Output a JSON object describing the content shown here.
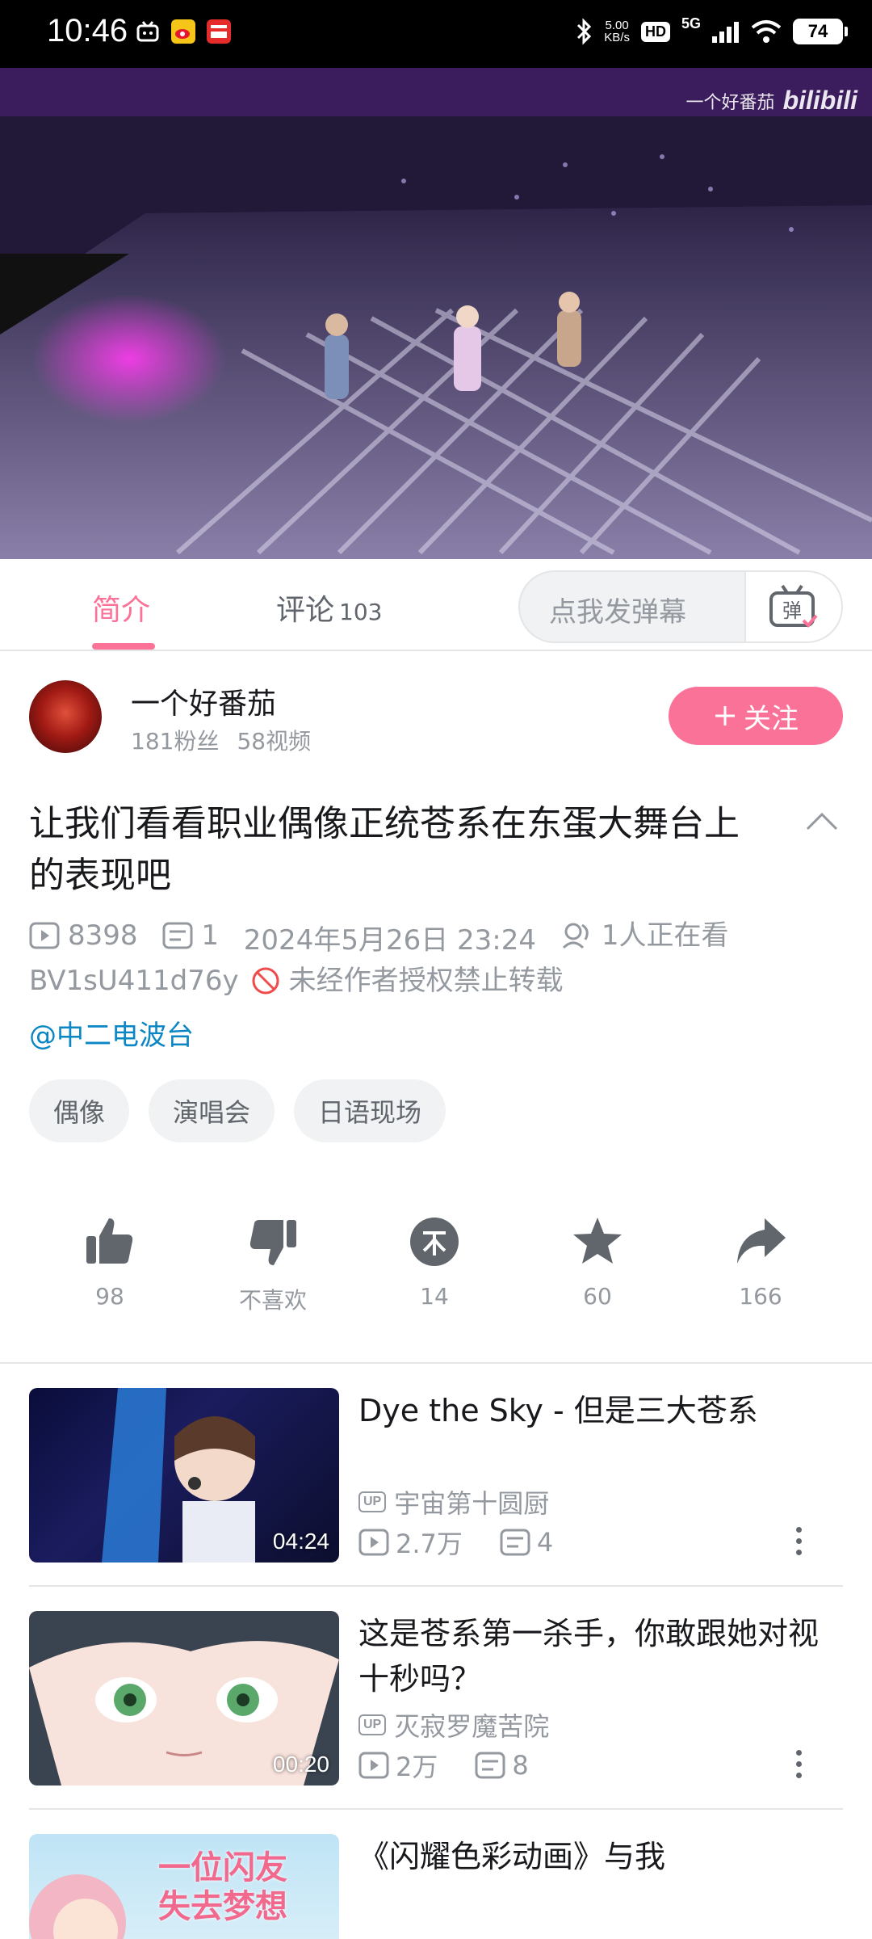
{
  "status_bar": {
    "time": "10:46",
    "speed_value": "5.00",
    "speed_unit": "KB/s",
    "hd": "HD",
    "network": "5G",
    "battery": "74"
  },
  "video": {
    "watermark_name": "一个好番茄",
    "watermark_logo": "bilibili"
  },
  "tabs": {
    "intro": "简介",
    "comments": "评论",
    "comments_count": "103",
    "danmu_placeholder": "点我发弹幕",
    "danmu_button": "弹"
  },
  "uploader": {
    "name": "一个好番茄",
    "fans": "181粉丝",
    "videos": "58视频",
    "follow": "关注"
  },
  "title": "让我们看看职业偶像正统苍系在东蛋大舞台上的表现吧",
  "meta": {
    "plays": "8398",
    "danmaku": "1",
    "date": "2024年5月26日 23:24",
    "watching": "1人正在看",
    "bvid": "BV1sU411d76y",
    "copyright": "未经作者授权禁止转载",
    "mention": "@中二电波台"
  },
  "tags": [
    "偶像",
    "演唱会",
    "日语现场"
  ],
  "actions": {
    "like": "98",
    "dislike": "不喜欢",
    "coin": "14",
    "favorite": "60",
    "share": "166"
  },
  "related": [
    {
      "title": "Dye the Sky - 但是三大苍系",
      "duration": "04:24",
      "up": "宇宙第十圆厨",
      "plays": "2.7万",
      "danmaku": "4"
    },
    {
      "title": "这是苍系第一杀手，你敢跟她对视十秒吗？",
      "duration": "00:20",
      "up": "灭寂罗魔苦院",
      "plays": "2万",
      "danmaku": "8"
    },
    {
      "title": "《闪耀色彩动画》与我",
      "thumb_text_1": "一位闪友",
      "thumb_text_2": "失去梦想"
    }
  ],
  "colors": {
    "accent": "#fb7299",
    "link": "#0a86c4",
    "muted": "#9499a0"
  }
}
